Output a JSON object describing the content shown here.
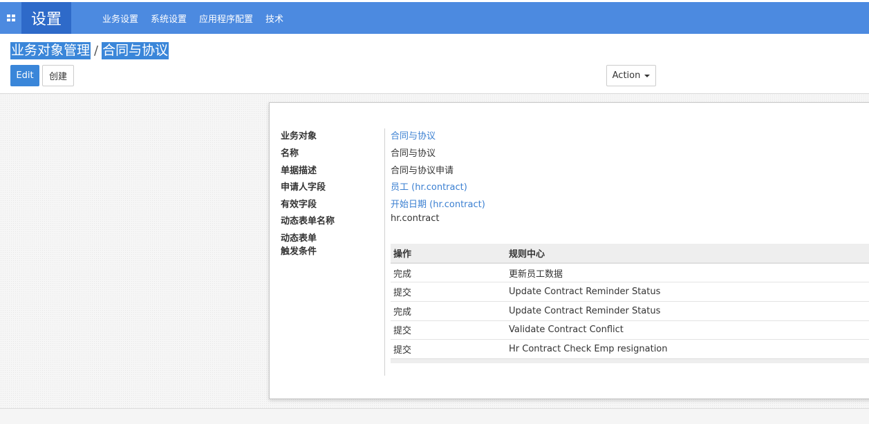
{
  "brand": "设置",
  "nav": [
    "业务设置",
    "系统设置",
    "应用程序配置",
    "技术"
  ],
  "breadcrumb": {
    "parent": "业务对象管理",
    "separator": "/",
    "current": "合同与协议"
  },
  "buttons": {
    "edit": "Edit",
    "create": "创建",
    "action": "Action"
  },
  "fields": [
    {
      "label": "业务对象",
      "value": "合同与协议",
      "is_link": true
    },
    {
      "label": "名称",
      "value": "合同与协议",
      "is_link": false
    },
    {
      "label": "单据描述",
      "value": "合同与协议申请",
      "is_link": false
    },
    {
      "label": "申请人字段",
      "value": "员工 (hr.contract)",
      "is_link": true
    },
    {
      "label": "有效字段",
      "value": "开始日期 (hr.contract)",
      "is_link": true
    },
    {
      "label": "动态表单名称",
      "value": "hr.contract",
      "is_link": false
    }
  ],
  "trigger_label": {
    "line1": "动态表单",
    "line2": "触发条件"
  },
  "table": {
    "columns": [
      "操作",
      "规则中心"
    ],
    "rows": [
      [
        "完成",
        "更新员工数据"
      ],
      [
        "提交",
        "Update Contract Reminder Status"
      ],
      [
        "完成",
        "Update Contract Reminder Status"
      ],
      [
        "提交",
        "Validate Contract Conflict"
      ],
      [
        "提交",
        "Hr Contract Check Emp resignation"
      ]
    ]
  },
  "colors": {
    "nav_bg": "#4c8ae0",
    "brand_bg": "#2e6ac9",
    "primary": "#3a86d9",
    "link": "#3a7fd1"
  }
}
